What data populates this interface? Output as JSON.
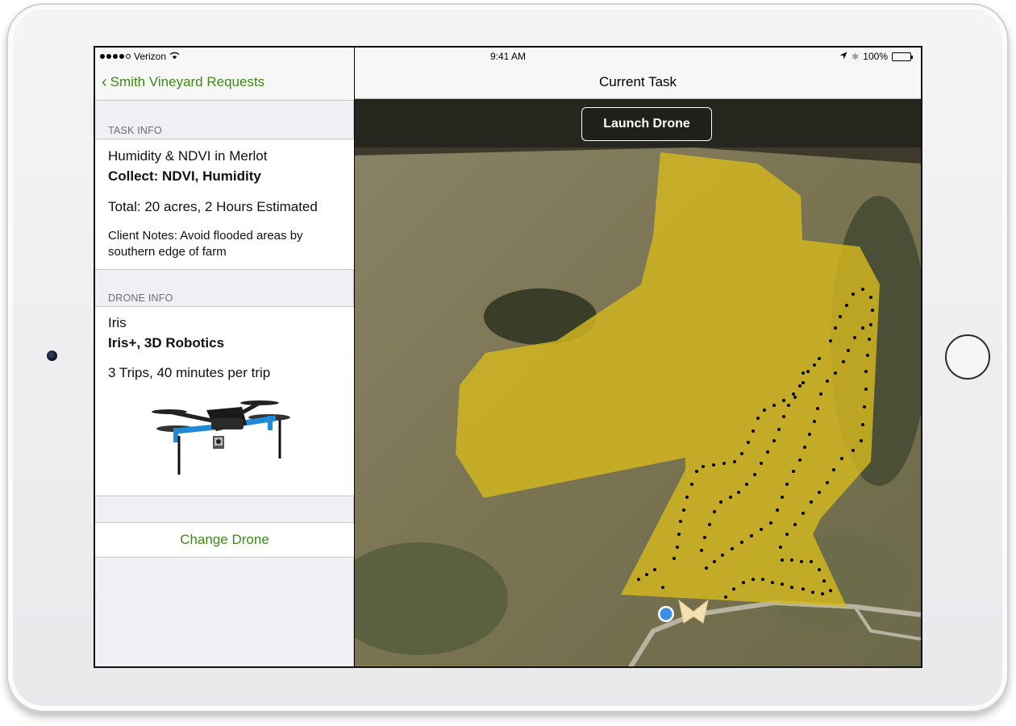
{
  "status_bar": {
    "carrier": "Verizon",
    "time": "9:41 AM",
    "battery": "100%"
  },
  "sidebar": {
    "back_label": "Smith Vineyard Requests",
    "task_info": {
      "header": "TASK INFO",
      "name": "Humidity & NDVI in Merlot",
      "collect": "Collect: NDVI, Humidity",
      "total": "Total: 20 acres, 2 Hours Estimated",
      "notes": "Client Notes: Avoid flooded areas by southern edge of farm"
    },
    "drone_info": {
      "header": "DRONE INFO",
      "name": "Iris",
      "model": "Iris+, 3D Robotics",
      "trips": "3 Trips, 40 minutes per trip"
    },
    "change_drone_label": "Change Drone"
  },
  "main": {
    "title": "Current Task",
    "launch_label": "Launch Drone"
  },
  "colors": {
    "accent": "#3d8b16",
    "field_overlay": "#d4b81e",
    "location_dot": "#3b8fe8"
  }
}
